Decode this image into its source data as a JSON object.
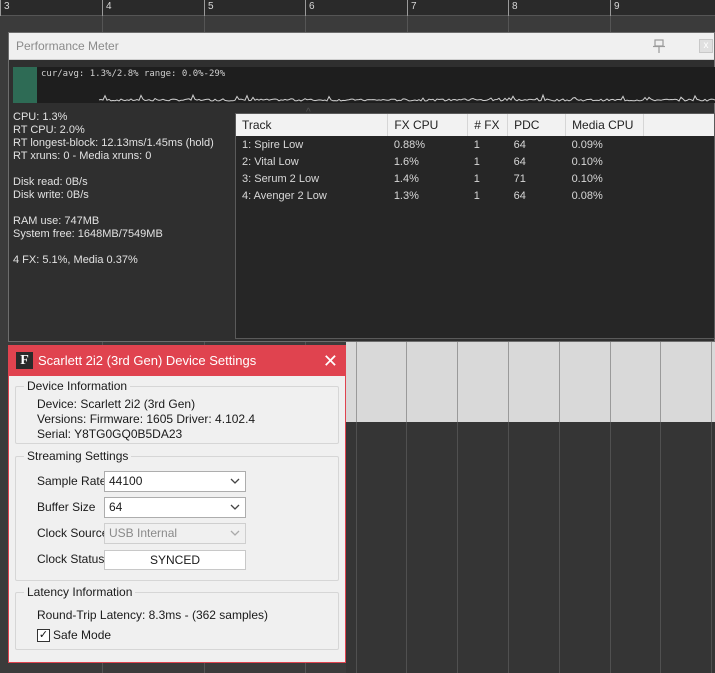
{
  "ruler": {
    "marks": [
      "3",
      "4",
      "5",
      "6",
      "7",
      "8",
      "9"
    ]
  },
  "perf_meter": {
    "title": "Performance Meter",
    "graph_caption": "cur/avg: 1.3%/2.8%  range: 0.0%-29%",
    "stats": {
      "cpu": "CPU: 1.3%",
      "rt_cpu": "RT CPU: 2.0%",
      "rt_longest": "RT longest-block: 12.13ms/1.45ms (hold)",
      "xruns": "RT xruns: 0 - Media xruns: 0",
      "disk_read": "Disk read: 0B/s",
      "disk_write": "Disk write: 0B/s",
      "ram_use": "RAM use: 747MB",
      "system_free": "System free: 1648MB/7549MB",
      "fx_summary": "4 FX: 5.1%, Media 0.37%"
    },
    "table": {
      "headers": [
        "Track",
        "FX CPU",
        "# FX",
        "PDC",
        "Media CPU"
      ],
      "rows": [
        [
          "1: Spire Low",
          "0.88%",
          "1",
          "64",
          "0.09%"
        ],
        [
          "2: Vital Low",
          "1.6%",
          "1",
          "64",
          "0.10%"
        ],
        [
          "3: Serum 2 Low",
          "1.4%",
          "1",
          "71",
          "0.10%"
        ],
        [
          "4: Avenger 2 Low",
          "1.3%",
          "1",
          "64",
          "0.08%"
        ]
      ]
    }
  },
  "device_settings": {
    "title": "Scarlett 2i2 (3rd Gen) Device Settings",
    "logo_letter": "F",
    "close_glyph": "✕",
    "device_info": {
      "legend": "Device Information",
      "device": "Device: Scarlett 2i2 (3rd Gen)",
      "versions": "Versions: Firmware: 1605  Driver: 4.102.4",
      "serial": "Serial: Y8TG0GQ0B5DA23"
    },
    "streaming": {
      "legend": "Streaming Settings",
      "sample_rate_label": "Sample Rate",
      "sample_rate_value": "44100",
      "buffer_size_label": "Buffer Size",
      "buffer_size_value": "64",
      "clock_source_label": "Clock Source",
      "clock_source_value": "USB Internal",
      "clock_status_label": "Clock Status",
      "clock_status_value": "SYNCED"
    },
    "latency": {
      "legend": "Latency Information",
      "round_trip": "Round-Trip Latency:   8.3ms - (362 samples)",
      "safe_mode_label": "Safe Mode",
      "safe_mode_checked": true
    }
  },
  "colors": {
    "dialog_accent": "#e0434f",
    "meter_bar": "#2e6b55"
  }
}
